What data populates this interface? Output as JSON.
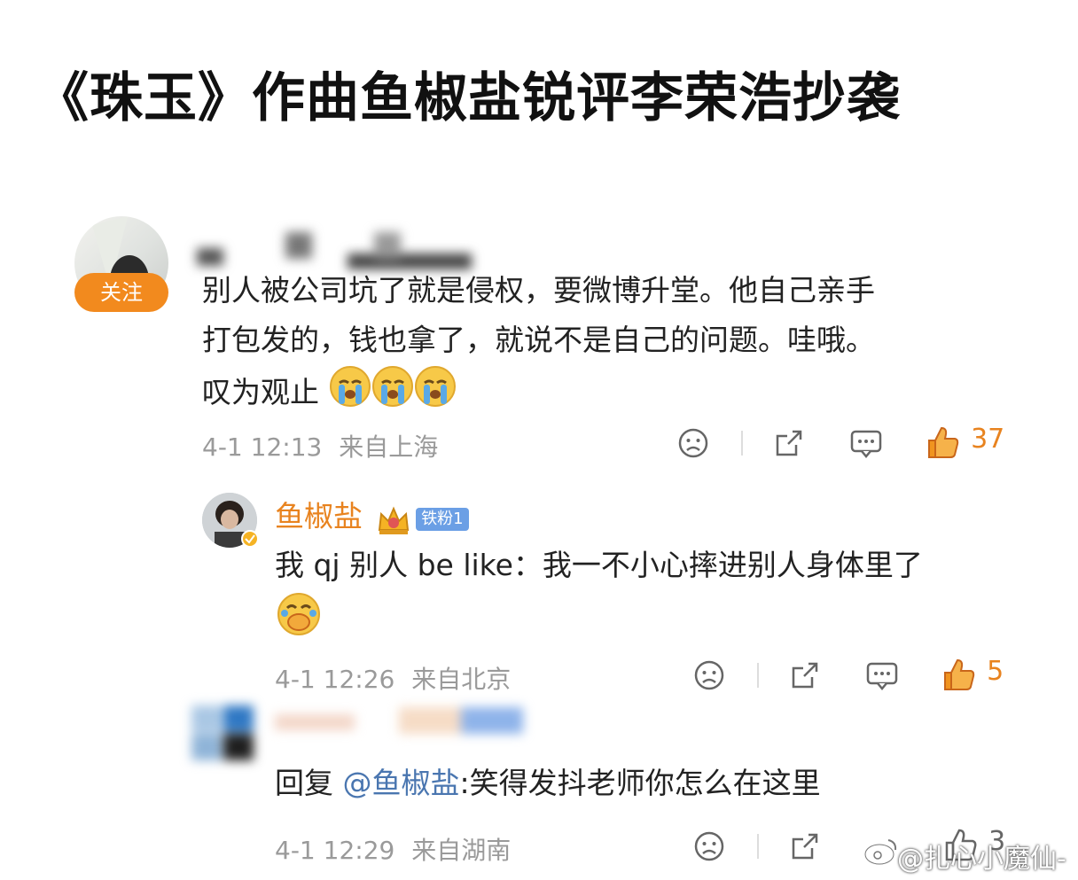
{
  "title": "《珠玉》作曲鱼椒盐锐评李荣浩抄袭",
  "comment1": {
    "follow_label": "关注",
    "line1": "别人被公司坑了就是侵权，要微博升堂。他自己亲手",
    "line2": "打包发的，钱也拿了，就说不是自己的问题。哇哦。",
    "line3": "叹为观止",
    "emojis": [
      "crying-emoji",
      "crying-emoji",
      "crying-emoji"
    ],
    "time": "4-1 12:13",
    "location": "来自上海",
    "like_count": "37"
  },
  "reply1": {
    "username": "鱼椒盐",
    "fan_badge": "铁粉1",
    "text": "我 qj 别人 be like：我一不小心摔进别人身体里了",
    "emoji": "laughing-tears-emoji",
    "time": "4-1 12:26",
    "location": "来自北京",
    "like_count": "5"
  },
  "reply2": {
    "prefix": "回复 ",
    "mention": "@鱼椒盐",
    "text": ":笑得发抖老师你怎么在这里",
    "time": "4-1 12:29",
    "location": "来自湖南",
    "like_count": "3"
  },
  "watermark": "@扎心小魔仙-",
  "colors": {
    "accent_orange": "#e8831f",
    "follow_button": "#f28a1e",
    "meta_gray": "#9a9a9a",
    "mention_blue": "#4a76b0"
  }
}
